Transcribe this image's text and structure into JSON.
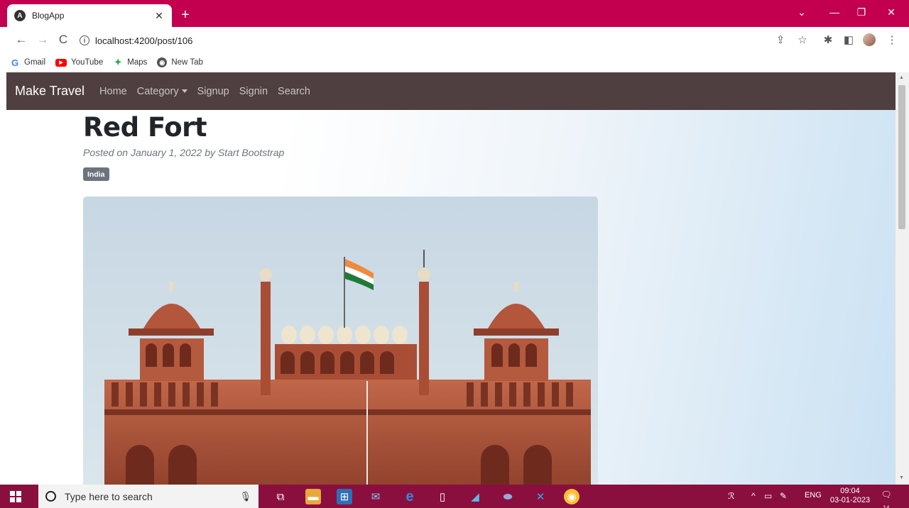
{
  "browser": {
    "tab_title": "BlogApp",
    "tab_favicon": "A",
    "url": "localhost:4200/post/106",
    "bookmarks": [
      {
        "label": "Gmail",
        "icon": "google-icon"
      },
      {
        "label": "YouTube",
        "icon": "youtube-icon"
      },
      {
        "label": "Maps",
        "icon": "maps-icon"
      },
      {
        "label": "New Tab",
        "icon": "new-tab-icon"
      }
    ],
    "accent_color": "#c2004f"
  },
  "navbar": {
    "brand": "Make Travel",
    "links": [
      "Home",
      "Category",
      "Signup",
      "Signin",
      "Search"
    ],
    "background": "#4f3f40"
  },
  "post": {
    "title": "Red Fort",
    "meta": "Posted on January 1, 2022 by Start Bootstrap",
    "badge": "India",
    "image_alt": "Red Fort"
  },
  "taskbar": {
    "search_placeholder": "Type here to search",
    "language": "ENG",
    "time": "09:04",
    "date": "03-01-2023",
    "notification_count": "14",
    "background": "#8a0f3e"
  }
}
